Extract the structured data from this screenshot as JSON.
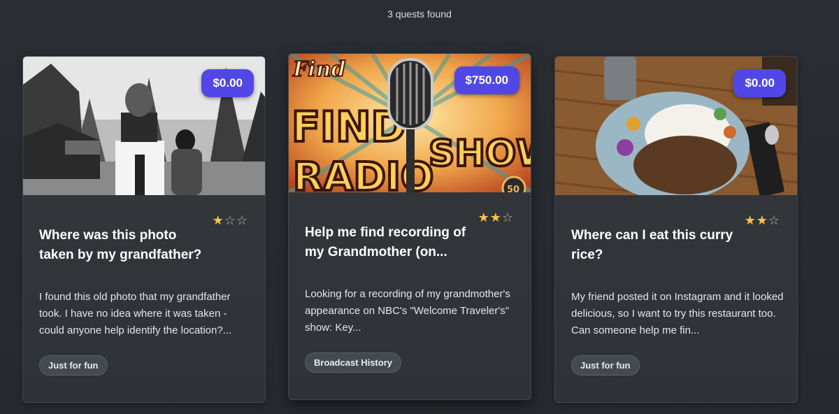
{
  "results": {
    "count_text": "3 quests found"
  },
  "quests": [
    {
      "price": "$0.00",
      "rating": 1,
      "rating_max": 3,
      "title": "Where was this photo taken by my grandfather?",
      "description": "I found this old photo that my grandfather took. I have no idea where it was taken - could anyone help identify the location?...",
      "tag": "Just for fun",
      "image": "black-and-white photo of a bust statue on a pedestal with trees"
    },
    {
      "price": "$750.00",
      "rating": 2,
      "rating_max": 3,
      "title": "Help me find recording of my Grandmother (on...",
      "description": "Looking for a recording of my grandmother's appearance on NBC's \"Welcome Traveler's\" show: Key...",
      "tag": "Broadcast History",
      "image": "retro poster with microphone",
      "image_text": {
        "line1": "FIND",
        "line2": "RADIO",
        "line3": "SHOW",
        "corner": "Find",
        "number": "50"
      }
    },
    {
      "price": "$0.00",
      "rating": 2,
      "rating_max": 3,
      "title": "Where can I eat this curry rice?",
      "description": "My friend posted it on Instagram and it looked delicious, so I want to try this restaurant too. Can someone help me fin...",
      "tag": "Just for fun",
      "image": "plate of curry rice on wooden table"
    }
  ],
  "colors": {
    "price_badge": "#5147e6",
    "star_filled": "#f3c54b",
    "background": "#2a2e33",
    "card": "#34383d"
  }
}
